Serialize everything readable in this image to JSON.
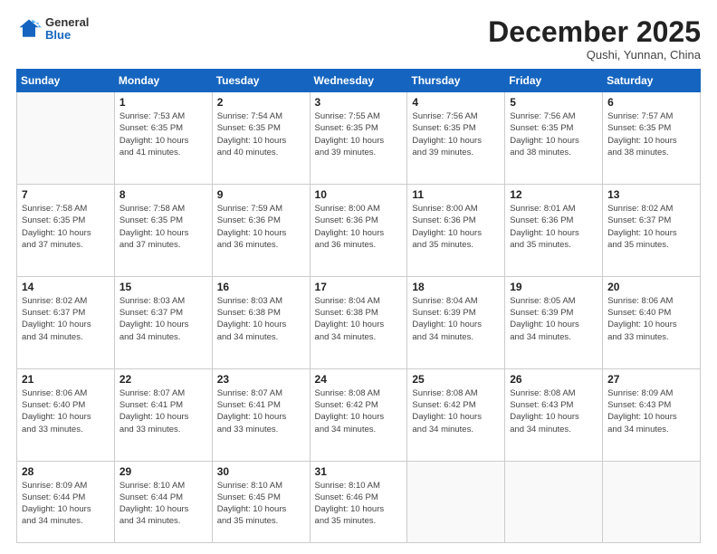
{
  "logo": {
    "general": "General",
    "blue": "Blue"
  },
  "header": {
    "month_title": "December 2025",
    "subtitle": "Qushi, Yunnan, China"
  },
  "weekdays": [
    "Sunday",
    "Monday",
    "Tuesday",
    "Wednesday",
    "Thursday",
    "Friday",
    "Saturday"
  ],
  "weeks": [
    [
      {
        "day": "",
        "info": ""
      },
      {
        "day": "1",
        "info": "Sunrise: 7:53 AM\nSunset: 6:35 PM\nDaylight: 10 hours\nand 41 minutes."
      },
      {
        "day": "2",
        "info": "Sunrise: 7:54 AM\nSunset: 6:35 PM\nDaylight: 10 hours\nand 40 minutes."
      },
      {
        "day": "3",
        "info": "Sunrise: 7:55 AM\nSunset: 6:35 PM\nDaylight: 10 hours\nand 39 minutes."
      },
      {
        "day": "4",
        "info": "Sunrise: 7:56 AM\nSunset: 6:35 PM\nDaylight: 10 hours\nand 39 minutes."
      },
      {
        "day": "5",
        "info": "Sunrise: 7:56 AM\nSunset: 6:35 PM\nDaylight: 10 hours\nand 38 minutes."
      },
      {
        "day": "6",
        "info": "Sunrise: 7:57 AM\nSunset: 6:35 PM\nDaylight: 10 hours\nand 38 minutes."
      }
    ],
    [
      {
        "day": "7",
        "info": "Sunrise: 7:58 AM\nSunset: 6:35 PM\nDaylight: 10 hours\nand 37 minutes."
      },
      {
        "day": "8",
        "info": "Sunrise: 7:58 AM\nSunset: 6:35 PM\nDaylight: 10 hours\nand 37 minutes."
      },
      {
        "day": "9",
        "info": "Sunrise: 7:59 AM\nSunset: 6:36 PM\nDaylight: 10 hours\nand 36 minutes."
      },
      {
        "day": "10",
        "info": "Sunrise: 8:00 AM\nSunset: 6:36 PM\nDaylight: 10 hours\nand 36 minutes."
      },
      {
        "day": "11",
        "info": "Sunrise: 8:00 AM\nSunset: 6:36 PM\nDaylight: 10 hours\nand 35 minutes."
      },
      {
        "day": "12",
        "info": "Sunrise: 8:01 AM\nSunset: 6:36 PM\nDaylight: 10 hours\nand 35 minutes."
      },
      {
        "day": "13",
        "info": "Sunrise: 8:02 AM\nSunset: 6:37 PM\nDaylight: 10 hours\nand 35 minutes."
      }
    ],
    [
      {
        "day": "14",
        "info": "Sunrise: 8:02 AM\nSunset: 6:37 PM\nDaylight: 10 hours\nand 34 minutes."
      },
      {
        "day": "15",
        "info": "Sunrise: 8:03 AM\nSunset: 6:37 PM\nDaylight: 10 hours\nand 34 minutes."
      },
      {
        "day": "16",
        "info": "Sunrise: 8:03 AM\nSunset: 6:38 PM\nDaylight: 10 hours\nand 34 minutes."
      },
      {
        "day": "17",
        "info": "Sunrise: 8:04 AM\nSunset: 6:38 PM\nDaylight: 10 hours\nand 34 minutes."
      },
      {
        "day": "18",
        "info": "Sunrise: 8:04 AM\nSunset: 6:39 PM\nDaylight: 10 hours\nand 34 minutes."
      },
      {
        "day": "19",
        "info": "Sunrise: 8:05 AM\nSunset: 6:39 PM\nDaylight: 10 hours\nand 34 minutes."
      },
      {
        "day": "20",
        "info": "Sunrise: 8:06 AM\nSunset: 6:40 PM\nDaylight: 10 hours\nand 33 minutes."
      }
    ],
    [
      {
        "day": "21",
        "info": "Sunrise: 8:06 AM\nSunset: 6:40 PM\nDaylight: 10 hours\nand 33 minutes."
      },
      {
        "day": "22",
        "info": "Sunrise: 8:07 AM\nSunset: 6:41 PM\nDaylight: 10 hours\nand 33 minutes."
      },
      {
        "day": "23",
        "info": "Sunrise: 8:07 AM\nSunset: 6:41 PM\nDaylight: 10 hours\nand 33 minutes."
      },
      {
        "day": "24",
        "info": "Sunrise: 8:08 AM\nSunset: 6:42 PM\nDaylight: 10 hours\nand 34 minutes."
      },
      {
        "day": "25",
        "info": "Sunrise: 8:08 AM\nSunset: 6:42 PM\nDaylight: 10 hours\nand 34 minutes."
      },
      {
        "day": "26",
        "info": "Sunrise: 8:08 AM\nSunset: 6:43 PM\nDaylight: 10 hours\nand 34 minutes."
      },
      {
        "day": "27",
        "info": "Sunrise: 8:09 AM\nSunset: 6:43 PM\nDaylight: 10 hours\nand 34 minutes."
      }
    ],
    [
      {
        "day": "28",
        "info": "Sunrise: 8:09 AM\nSunset: 6:44 PM\nDaylight: 10 hours\nand 34 minutes."
      },
      {
        "day": "29",
        "info": "Sunrise: 8:10 AM\nSunset: 6:44 PM\nDaylight: 10 hours\nand 34 minutes."
      },
      {
        "day": "30",
        "info": "Sunrise: 8:10 AM\nSunset: 6:45 PM\nDaylight: 10 hours\nand 35 minutes."
      },
      {
        "day": "31",
        "info": "Sunrise: 8:10 AM\nSunset: 6:46 PM\nDaylight: 10 hours\nand 35 minutes."
      },
      {
        "day": "",
        "info": ""
      },
      {
        "day": "",
        "info": ""
      },
      {
        "day": "",
        "info": ""
      }
    ]
  ]
}
